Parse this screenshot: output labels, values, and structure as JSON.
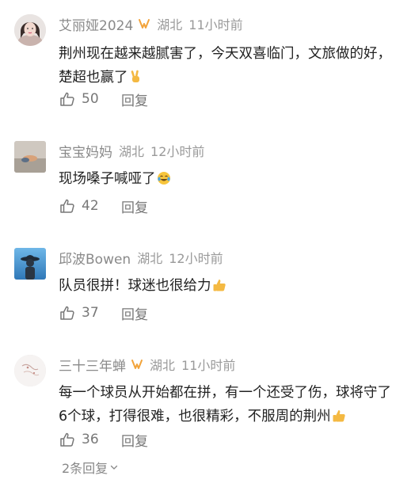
{
  "comments": [
    {
      "username": "艾丽娅2024",
      "has_badge": true,
      "location": "湖北",
      "time": "11小时前",
      "text": "荆州现在越来越腻害了，今天双喜临门，文旅做的好，楚超也赢了",
      "emoji": "victory-hand",
      "likes": "50",
      "reply_label": "回复"
    },
    {
      "username": "宝宝妈妈",
      "has_badge": false,
      "location": "湖北",
      "time": "12小时前",
      "text": "现场嗓子喊哑了",
      "emoji": "crying-laughing-face",
      "likes": "42",
      "reply_label": "回复"
    },
    {
      "username": "邱波Bowen",
      "has_badge": false,
      "location": "湖北",
      "time": "12小时前",
      "text": "队员很拼！球迷也很给力",
      "emoji": "thumbs-up",
      "likes": "37",
      "reply_label": "回复"
    },
    {
      "username": "三十三年蝉",
      "has_badge": true,
      "location": "湖北",
      "time": "11小时前",
      "text": "每一个球员从开始都在拼，有一个还受了伤，球将守了6个球，打得很难，也很精彩，不服周的荆州",
      "emoji": "thumbs-up",
      "likes": "36",
      "reply_label": "回复"
    }
  ],
  "more_replies": "2条回复",
  "colors": {
    "badge": "#f2a33a",
    "meta_text": "#8a8a8a",
    "body_text": "#222222"
  }
}
